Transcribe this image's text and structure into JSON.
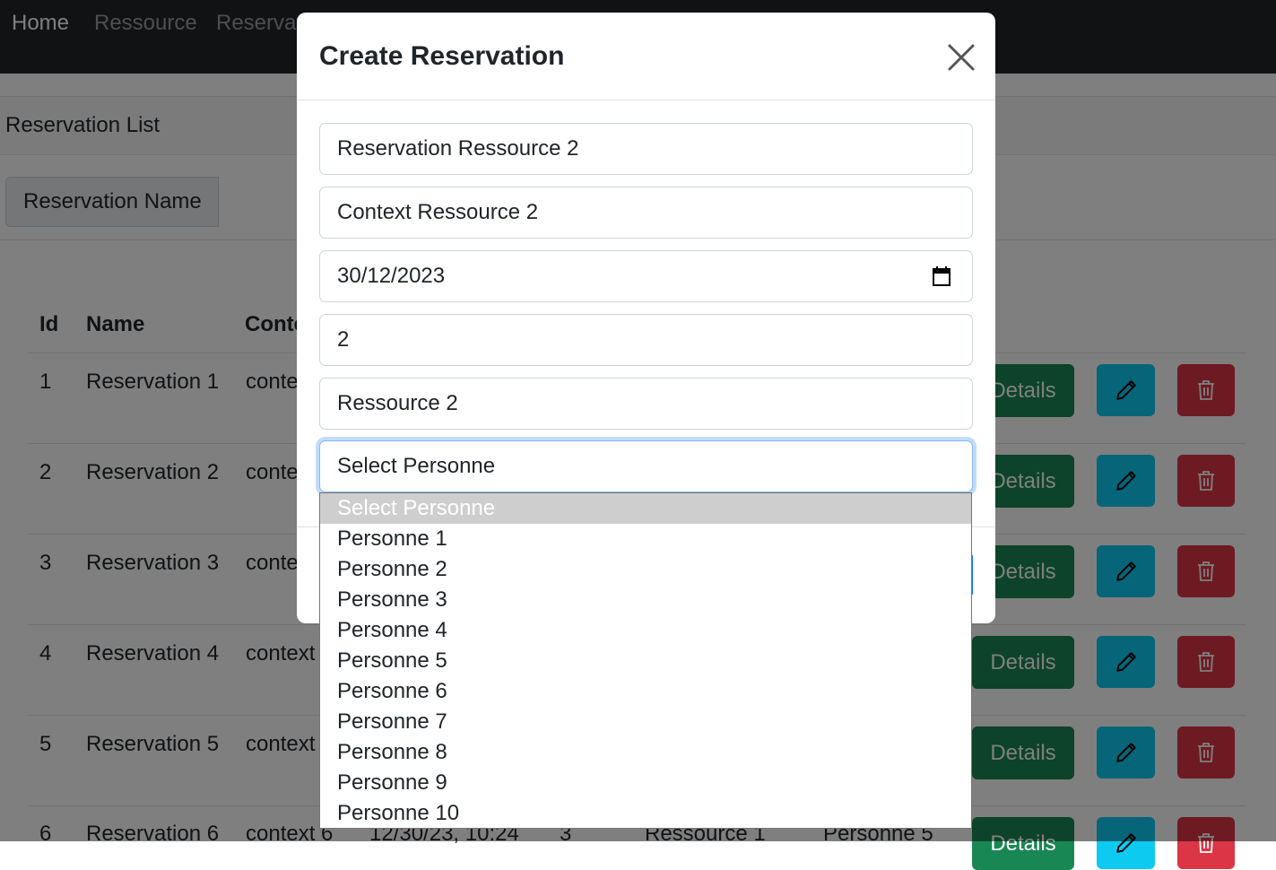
{
  "navbar": {
    "items": [
      {
        "label": "Home"
      },
      {
        "label": "Ressource"
      },
      {
        "label": "Reservat"
      }
    ]
  },
  "page": {
    "list_title": "Reservation List",
    "filter_label": "Reservation Name"
  },
  "table": {
    "headers": [
      "Id",
      "Name",
      "Conte"
    ],
    "rows": [
      {
        "id": "1",
        "name": "Reservation 1",
        "context": "conte"
      },
      {
        "id": "2",
        "name": "Reservation 2",
        "context": "conte"
      },
      {
        "id": "3",
        "name": "Reservation 3",
        "context": "conte"
      },
      {
        "id": "4",
        "name": "Reservation 4",
        "context": "context"
      },
      {
        "id": "5",
        "name": "Reservation 5",
        "context": "context"
      },
      {
        "id": "6",
        "name": "Reservation 6",
        "context": "context 6",
        "date": "12/30/23, 10:24",
        "qty": "3",
        "ressource": "Ressource 1",
        "personne": "Personne 5"
      }
    ],
    "details_label": "Details",
    "details_partial_label": "Details",
    "colors": {
      "details": "#198754",
      "edit": "#0dcaf0",
      "delete": "#dc3545"
    }
  },
  "modal": {
    "title": "Create Reservation",
    "fields": {
      "reservation_name": "Reservation Ressource 2",
      "context": "Context Ressource 2",
      "date": "30/12/2023",
      "quantity": "2",
      "ressource": "Ressource 2",
      "personne_select": "Select Personne"
    }
  },
  "dropdown": {
    "options": [
      "Select Personne",
      "Personne 1",
      "Personne 2",
      "Personne 3",
      "Personne 4",
      "Personne 5",
      "Personne 6",
      "Personne 7",
      "Personne 8",
      "Personne 9",
      "Personne 10"
    ],
    "selected_index": 0
  }
}
